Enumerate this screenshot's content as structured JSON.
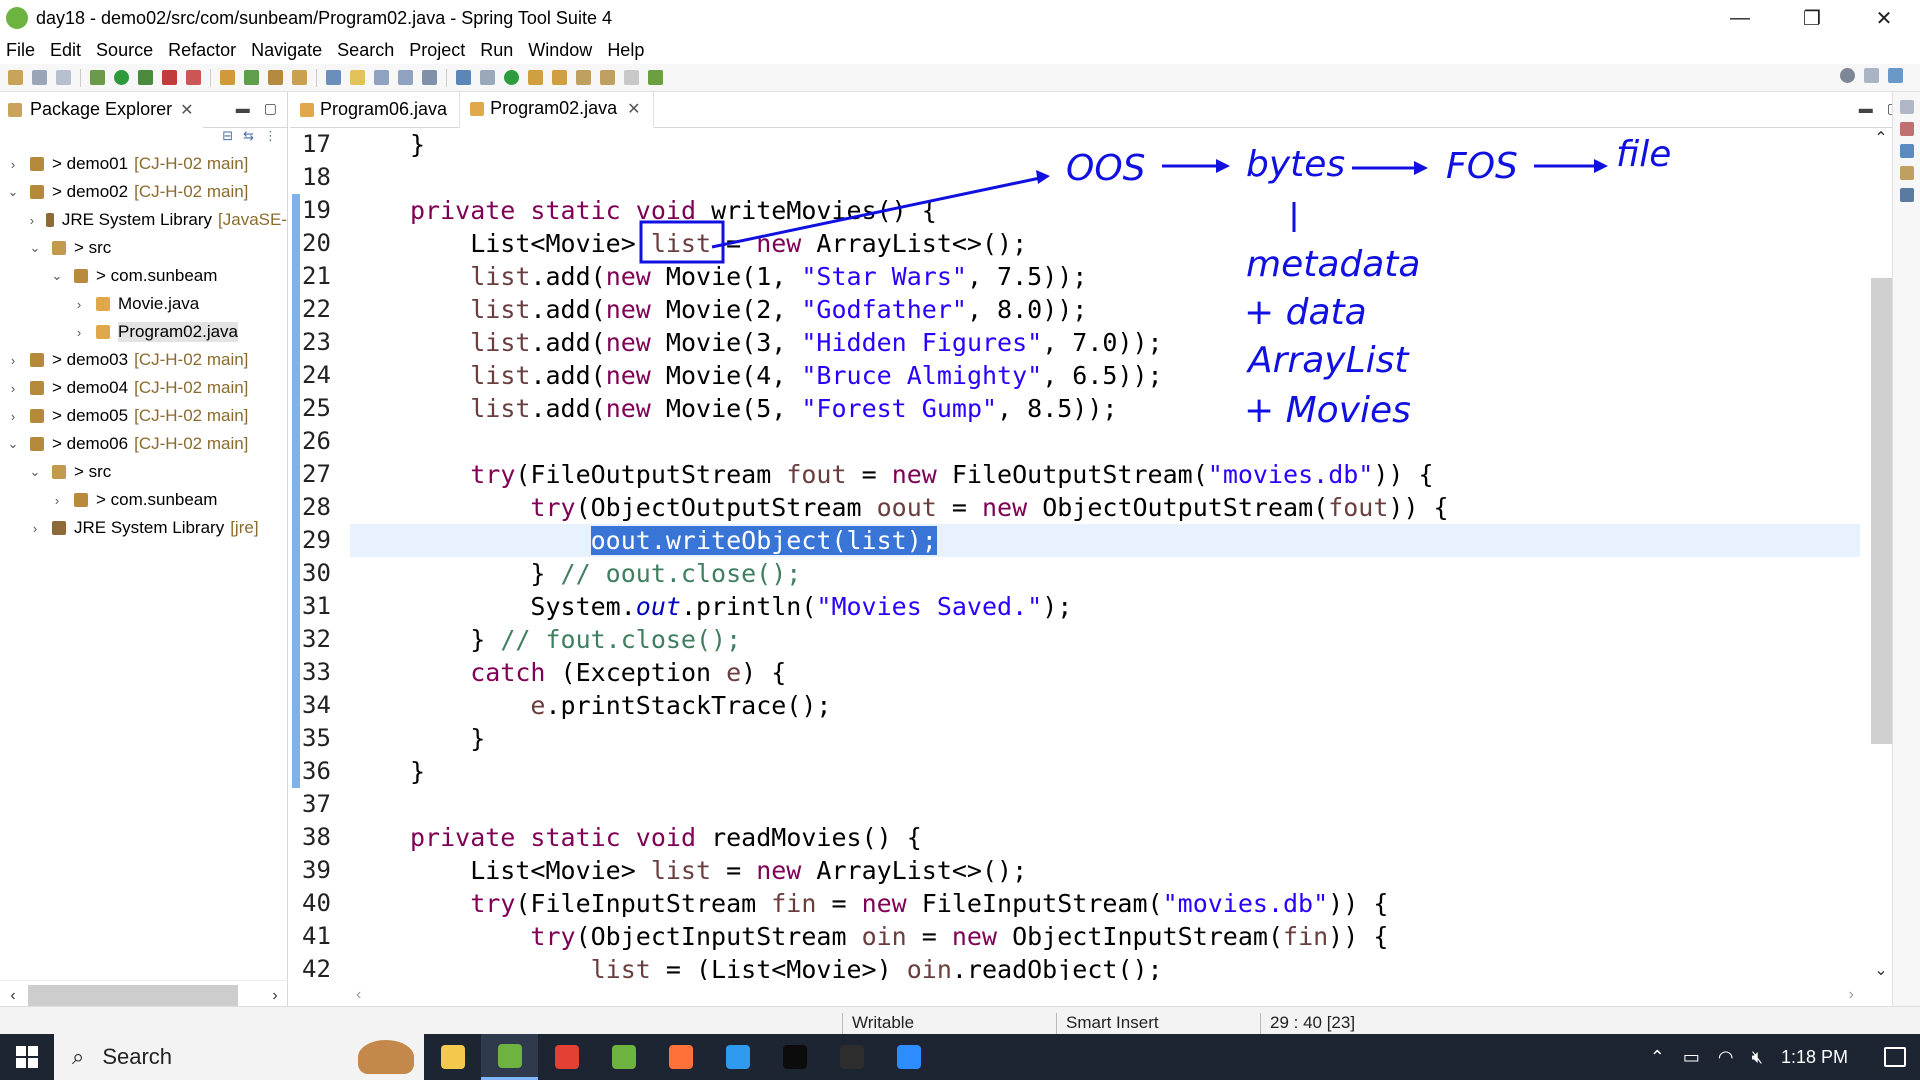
{
  "window": {
    "title": "day18 - demo02/src/com/sunbeam/Program02.java - Spring Tool Suite 4",
    "minimize": "—",
    "restore": "❐",
    "close": "✕"
  },
  "menu": [
    "File",
    "Edit",
    "Source",
    "Refactor",
    "Navigate",
    "Search",
    "Project",
    "Run",
    "Window",
    "Help"
  ],
  "explorer": {
    "tab_label": "Package Explorer",
    "items": [
      {
        "twisty": "›",
        "indent": 0,
        "icon": "project",
        "label": "> demo01",
        "dec": "[CJ-H-02 main]"
      },
      {
        "twisty": "⌄",
        "indent": 0,
        "icon": "project",
        "label": "> demo02",
        "dec": "[CJ-H-02 main]"
      },
      {
        "twisty": "›",
        "indent": 1,
        "icon": "lib",
        "label": "JRE System Library",
        "dec": "[JavaSE-"
      },
      {
        "twisty": "⌄",
        "indent": 1,
        "icon": "src",
        "label": "> src",
        "dec": ""
      },
      {
        "twisty": "⌄",
        "indent": 2,
        "icon": "pkg",
        "label": "> com.sunbeam",
        "dec": ""
      },
      {
        "twisty": "›",
        "indent": 3,
        "icon": "java",
        "label": "Movie.java",
        "dec": ""
      },
      {
        "twisty": "›",
        "indent": 3,
        "icon": "java",
        "label": "Program02.java",
        "dec": "",
        "selected": true
      },
      {
        "twisty": "›",
        "indent": 0,
        "icon": "project",
        "label": "> demo03",
        "dec": "[CJ-H-02 main]"
      },
      {
        "twisty": "›",
        "indent": 0,
        "icon": "project",
        "label": "> demo04",
        "dec": "[CJ-H-02 main]"
      },
      {
        "twisty": "›",
        "indent": 0,
        "icon": "project",
        "label": "> demo05",
        "dec": "[CJ-H-02 main]"
      },
      {
        "twisty": "⌄",
        "indent": 0,
        "icon": "project",
        "label": "> demo06",
        "dec": "[CJ-H-02 main]"
      },
      {
        "twisty": "⌄",
        "indent": 1,
        "icon": "src",
        "label": "> src",
        "dec": ""
      },
      {
        "twisty": "›",
        "indent": 2,
        "icon": "pkg",
        "label": "> com.sunbeam",
        "dec": ""
      },
      {
        "twisty": "›",
        "indent": 1,
        "icon": "lib",
        "label": "JRE System Library",
        "dec": "[jre]"
      }
    ]
  },
  "editor": {
    "tabs": [
      {
        "label": "Program06.java",
        "active": false
      },
      {
        "label": "Program02.java",
        "active": true
      }
    ],
    "line_numbers": [
      "17",
      "18",
      "19",
      "20",
      "21",
      "22",
      "23",
      "24",
      "25",
      "26",
      "27",
      "28",
      "29",
      "30",
      "31",
      "32",
      "33",
      "34",
      "35",
      "36",
      "37",
      "38",
      "39",
      "40",
      "41",
      "42"
    ],
    "current_line": "29"
  },
  "annotations": {
    "oos": "OOS",
    "bytes": "bytes",
    "fos": "FOS",
    "file": "file",
    "metadata": "metadata",
    "plus_data": "+ data",
    "arraylist": "ArrayList",
    "plus_movies": "+ Movies"
  },
  "status": {
    "writable": "Writable",
    "insert_mode": "Smart Insert",
    "position": "29 : 40 [23]"
  },
  "taskbar": {
    "search_placeholder": "Search",
    "time": "1:18 PM",
    "apps": [
      {
        "name": "file-explorer",
        "color": "#f2c94c"
      },
      {
        "name": "spring-tool-suite",
        "color": "#6db33f",
        "active": true
      },
      {
        "name": "chrome",
        "color": "#e34133"
      },
      {
        "name": "spring-tool-suite-2",
        "color": "#6db33f"
      },
      {
        "name": "firefox",
        "color": "#ff7139"
      },
      {
        "name": "vscode",
        "color": "#2f9bef"
      },
      {
        "name": "terminal-1",
        "color": "#0c0c0c"
      },
      {
        "name": "terminal-2",
        "color": "#2d2d2d"
      },
      {
        "name": "zoom",
        "color": "#2d8cff"
      }
    ]
  }
}
